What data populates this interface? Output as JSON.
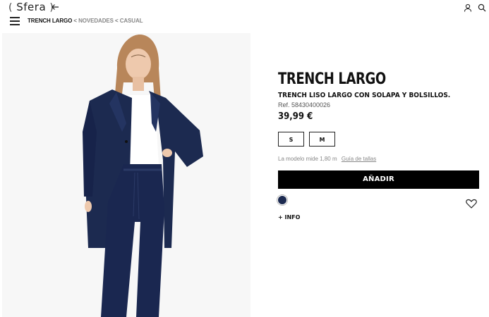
{
  "header": {
    "logo": "Sfera",
    "back_icon": "arrow-left-icon",
    "account_icon": "user-icon",
    "search_icon": "search-icon",
    "menu_icon": "hamburger-icon"
  },
  "breadcrumb": {
    "current": "TRENCH LARGO",
    "sep1": "<",
    "item1": "NOVEDADES",
    "sep2": "<",
    "item2": "CASUAL"
  },
  "product": {
    "title": "TRENCH LARGO",
    "subtitle": "TRENCH LISO LARGO CON SOLAPA Y BOLSILLOS.",
    "ref": "Ref. 58430400026",
    "price": "39,99 €",
    "sizes": [
      "S",
      "M"
    ],
    "model_note": "La modelo mide 1,80 m",
    "size_guide": "Guía de tallas",
    "add_button": "AÑADIR",
    "color_swatch": "#1c2a50",
    "favorite_icon": "heart-icon",
    "more_info": "+ INFO"
  },
  "colors": {
    "accent": "#000000",
    "navy": "#1c2a50"
  }
}
